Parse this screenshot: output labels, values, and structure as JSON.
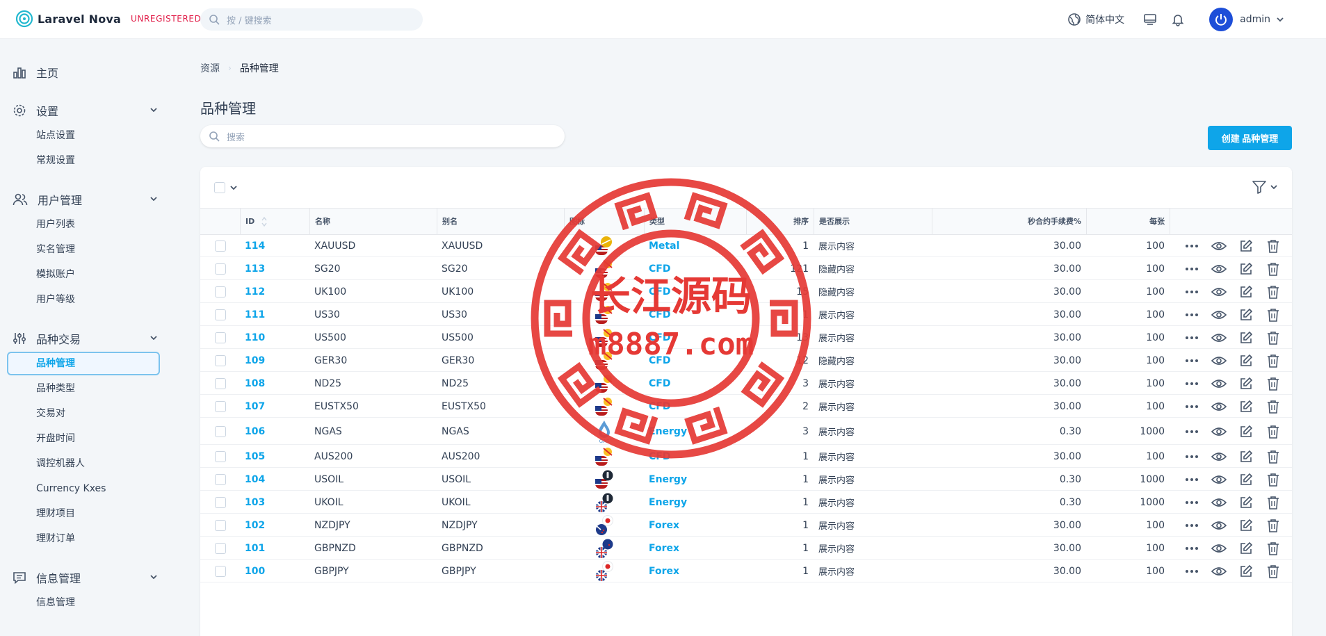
{
  "brand": {
    "name": "Laravel Nova",
    "tag": "UNREGISTERED",
    "accent": "#0ea5e9"
  },
  "top_search": {
    "placeholder": "按 / 键搜索"
  },
  "top_right": {
    "language": "简体中文",
    "user": "admin"
  },
  "sidebar": {
    "home": "主页",
    "groups": [
      {
        "label": "设置",
        "icon": "gear-icon",
        "items": [
          "站点设置",
          "常规设置"
        ]
      },
      {
        "label": "用户管理",
        "icon": "users-icon",
        "items": [
          "用户列表",
          "实名管理",
          "模拟账户",
          "用户等级"
        ]
      },
      {
        "label": "品种交易",
        "icon": "sliders-icon",
        "items": [
          "品种管理",
          "品种类型",
          "交易对",
          "开盘时间",
          "调控机器人",
          "Currency Kxes",
          "理财项目",
          "理财订单"
        ],
        "active": "品种管理"
      },
      {
        "label": "信息管理",
        "icon": "message-icon",
        "items": [
          "信息管理"
        ]
      }
    ]
  },
  "breadcrumb": {
    "root": "资源",
    "current": "品种管理"
  },
  "page_title": "品种管理",
  "resource_search": {
    "placeholder": "搜索"
  },
  "create_button": "创建 品种管理",
  "table": {
    "columns": [
      "ID",
      "名称",
      "别名",
      "图标",
      "类型",
      "排序",
      "是否展示",
      "秒合约手续费%",
      "每张"
    ],
    "rows": [
      {
        "id": "114",
        "name": "XAUUSD",
        "alias": "XAUUSD",
        "flag": "us",
        "badge": "gold",
        "type": "Metal",
        "sort": "1",
        "show": "展示内容",
        "fee": "30.00",
        "per": "100"
      },
      {
        "id": "113",
        "name": "SG20",
        "alias": "SG20",
        "flag": "us",
        "badge": "index",
        "type": "CFD",
        "sort": "121",
        "show": "隐藏内容",
        "fee": "30.00",
        "per": "100"
      },
      {
        "id": "112",
        "name": "UK100",
        "alias": "UK100",
        "flag": "us",
        "badge": "index",
        "type": "CFD",
        "sort": "15",
        "show": "隐藏内容",
        "fee": "30.00",
        "per": "100"
      },
      {
        "id": "111",
        "name": "US30",
        "alias": "US30",
        "flag": "us",
        "badge": "index",
        "type": "CFD",
        "sort": "1",
        "show": "展示内容",
        "fee": "30.00",
        "per": "100"
      },
      {
        "id": "110",
        "name": "US500",
        "alias": "US500",
        "flag": "us",
        "badge": "index",
        "type": "CFD",
        "sort": "13",
        "show": "展示内容",
        "fee": "30.00",
        "per": "100"
      },
      {
        "id": "109",
        "name": "GER30",
        "alias": "GER30",
        "flag": "us",
        "badge": "index",
        "type": "CFD",
        "sort": "12",
        "show": "隐藏内容",
        "fee": "30.00",
        "per": "100"
      },
      {
        "id": "108",
        "name": "ND25",
        "alias": "ND25",
        "flag": "us",
        "badge": "index",
        "type": "CFD",
        "sort": "3",
        "show": "展示内容",
        "fee": "30.00",
        "per": "100"
      },
      {
        "id": "107",
        "name": "EUSTX50",
        "alias": "EUSTX50",
        "flag": "us",
        "badge": "index",
        "type": "CFD",
        "sort": "2",
        "show": "展示内容",
        "fee": "30.00",
        "per": "100"
      },
      {
        "id": "106",
        "name": "NGAS",
        "alias": "NGAS",
        "flag": "gas",
        "badge": "",
        "type": "Energy",
        "sort": "3",
        "show": "展示内容",
        "fee": "0.30",
        "per": "1000"
      },
      {
        "id": "105",
        "name": "AUS200",
        "alias": "AUS200",
        "flag": "us",
        "badge": "index",
        "type": "CFD",
        "sort": "1",
        "show": "展示内容",
        "fee": "30.00",
        "per": "100"
      },
      {
        "id": "104",
        "name": "USOIL",
        "alias": "USOIL",
        "flag": "us",
        "badge": "oil",
        "type": "Energy",
        "sort": "1",
        "show": "展示内容",
        "fee": "0.30",
        "per": "1000"
      },
      {
        "id": "103",
        "name": "UKOIL",
        "alias": "UKOIL",
        "flag": "uk",
        "badge": "oil",
        "type": "Energy",
        "sort": "1",
        "show": "展示内容",
        "fee": "0.30",
        "per": "1000"
      },
      {
        "id": "102",
        "name": "NZDJPY",
        "alias": "NZDJPY",
        "flag": "nz",
        "badge": "jp",
        "type": "Forex",
        "sort": "1",
        "show": "展示内容",
        "fee": "30.00",
        "per": "100"
      },
      {
        "id": "101",
        "name": "GBPNZD",
        "alias": "GBPNZD",
        "flag": "uk",
        "badge": "nz",
        "type": "Forex",
        "sort": "1",
        "show": "展示内容",
        "fee": "30.00",
        "per": "100"
      },
      {
        "id": "100",
        "name": "GBPJPY",
        "alias": "GBPJPY",
        "flag": "uk",
        "badge": "jp",
        "type": "Forex",
        "sort": "1",
        "show": "展示内容",
        "fee": "30.00",
        "per": "100"
      }
    ]
  },
  "watermark": {
    "title": "长江源码",
    "url": "m8887.com",
    "color": "#e53935"
  },
  "icon_gas_text": "GAS"
}
